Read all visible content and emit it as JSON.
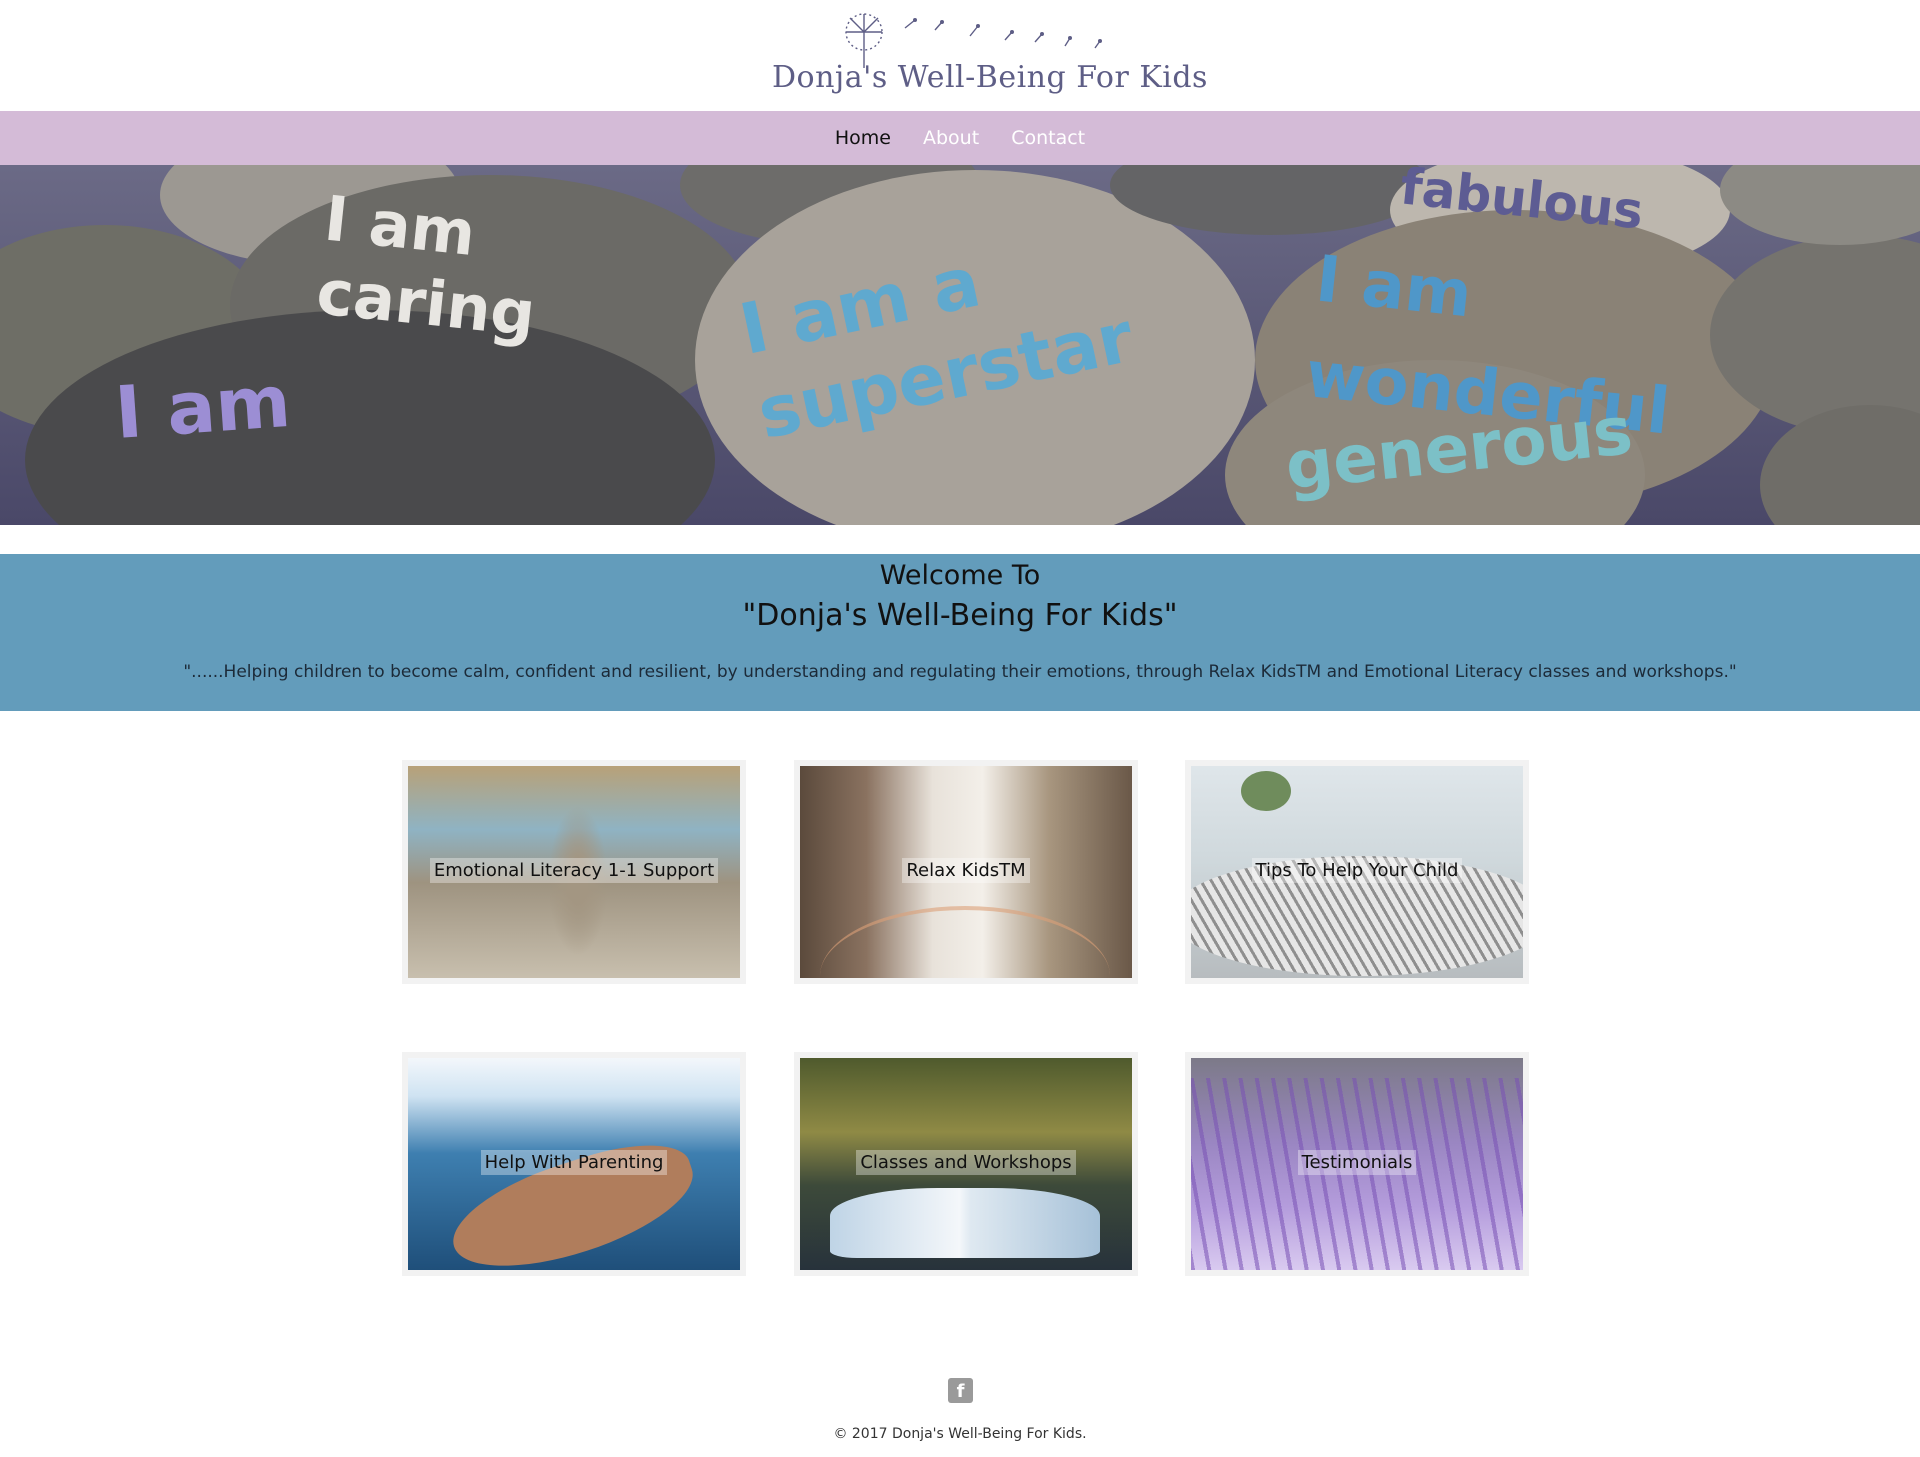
{
  "header": {
    "logo_text": "Donja's Well-Being For Kids"
  },
  "nav": {
    "items": [
      {
        "label": "Home"
      },
      {
        "label": "About"
      },
      {
        "label": "Contact"
      }
    ]
  },
  "hero": {
    "stones": [
      {
        "text": "I am caring"
      },
      {
        "text": "I am a superstar"
      },
      {
        "text": "I am wonderful"
      },
      {
        "text": "generous"
      },
      {
        "text": "fabulous"
      },
      {
        "text": "I am"
      }
    ]
  },
  "welcome": {
    "title": "Welcome To",
    "name": "\"Donja's Well-Being For Kids\"",
    "quote": "\"......Helping children to become calm, confident and resilient, by understanding and regulating their emotions, through Relax KidsTM and Emotional Literacy classes and workshops.\""
  },
  "tiles": [
    {
      "label": "Emotional Literacy 1-1 Support"
    },
    {
      "label": "Relax KidsTM"
    },
    {
      "label": "Tips To Help Your Child"
    },
    {
      "label": "Help With Parenting"
    },
    {
      "label": "Classes and Workshops"
    },
    {
      "label": "Testimonials"
    }
  ],
  "footer": {
    "facebook_glyph": "f",
    "copyright": "© 2017 Donja's Well-Being For Kids."
  }
}
